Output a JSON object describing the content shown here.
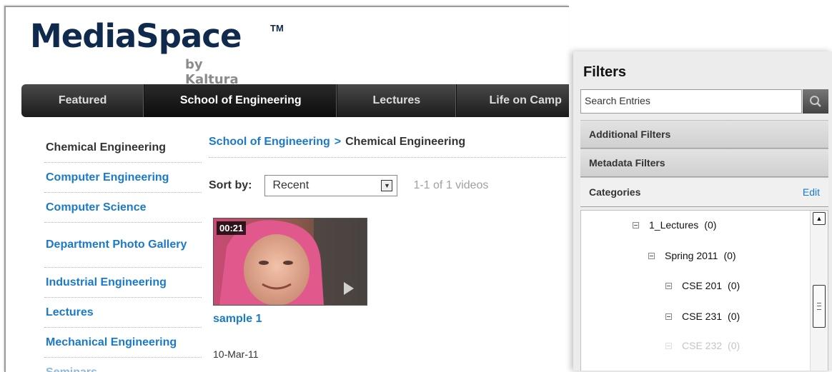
{
  "logo": {
    "main": "MediaSpace",
    "tm": "TM",
    "sub": "by Kaltura"
  },
  "nav": [
    {
      "label": "Featured"
    },
    {
      "label": "School of Engineering"
    },
    {
      "label": "Lectures"
    },
    {
      "label": "Life on Camp"
    }
  ],
  "sidebar": {
    "items": [
      {
        "label": "Chemical Engineering"
      },
      {
        "label": "Computer Engineering"
      },
      {
        "label": "Computer Science"
      },
      {
        "label": "Department Photo Gallery"
      },
      {
        "label": "Industrial Engineering"
      },
      {
        "label": "Lectures"
      },
      {
        "label": "Mechanical Engineering"
      },
      {
        "label": "Seminars"
      }
    ]
  },
  "breadcrumb": {
    "parent": "School of Engineering",
    "separator": ">",
    "current": "Chemical Engineering"
  },
  "sort": {
    "label": "Sort by:",
    "selected": "Recent",
    "count": "1-1 of 1 videos"
  },
  "video": {
    "duration": "00:21",
    "title": "sample 1",
    "date": "10-Mar-11"
  },
  "filters": {
    "title": "Filters",
    "search_value": "Search  Entries",
    "additional": "Additional Filters",
    "metadata": "Metadata Filters",
    "categories": "Categories",
    "edit": "Edit",
    "tree": [
      {
        "label": "1_Lectures",
        "count": "(0)"
      },
      {
        "label": "Spring 2011",
        "count": "(0)"
      },
      {
        "label": "CSE 201",
        "count": "(0)"
      },
      {
        "label": "CSE 231",
        "count": "(0)"
      },
      {
        "label": "CSE 232",
        "count": "(0)"
      }
    ]
  },
  "icons": {
    "search": "search-icon",
    "play": "play-icon",
    "dropdown": "chevron-down-icon"
  },
  "colors": {
    "link": "#1a7ac9",
    "logo": "#0f2a4d",
    "nav": "#1c1c1c"
  }
}
